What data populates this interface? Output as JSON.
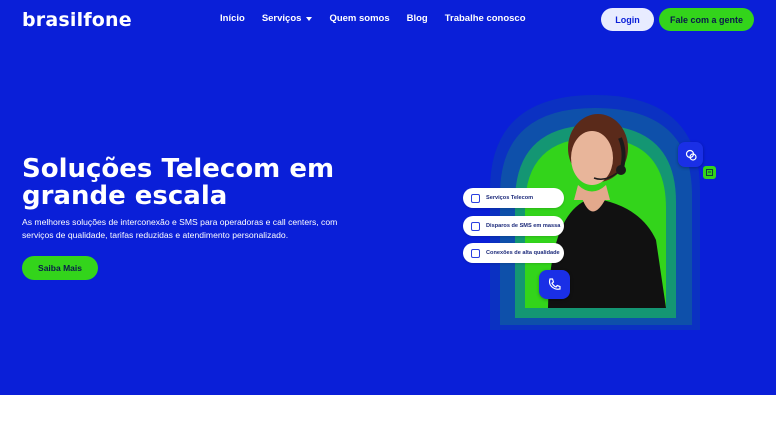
{
  "brand": {
    "logo_text": "brasilfone"
  },
  "nav": {
    "items": [
      {
        "label": "Início"
      },
      {
        "label": "Serviços",
        "has_dropdown": true
      },
      {
        "label": "Quem somos"
      },
      {
        "label": "Blog"
      },
      {
        "label": "Trabalhe conosco"
      }
    ],
    "login_label": "Login",
    "contact_label": "Fale com a gente"
  },
  "hero": {
    "title": "Soluções Telecom em grande escala",
    "subtitle": "As melhores soluções de interconexão e SMS para operadoras e call centers, com serviços de qualidade, tarifas reduzidas e atendimento personalizado.",
    "cta_label": "Saiba Mais"
  },
  "features": [
    {
      "label": "Serviços Telecom",
      "icon": "phone-icon"
    },
    {
      "label": "Disparos de SMS em massa",
      "icon": "send-icon"
    },
    {
      "label": "Conexões de alta qualidade",
      "icon": "network-icon"
    }
  ],
  "badges": {
    "chat_icon": "chat-icon",
    "phone_icon": "phone-icon"
  },
  "colors": {
    "hero_background": "#0a1fd8",
    "accent_green": "#33d41b",
    "login_background": "#e8ecff",
    "text_white": "#ffffff"
  }
}
